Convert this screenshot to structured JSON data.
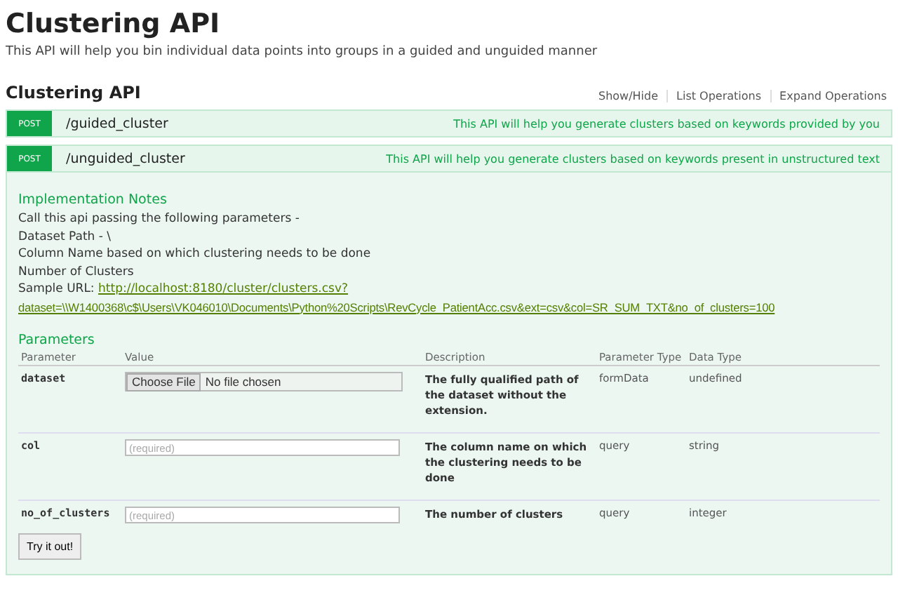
{
  "header": {
    "title": "Clustering API",
    "description": "This API will help you bin individual data points into groups in a guided and unguided manner"
  },
  "resource": {
    "name": "Clustering API",
    "links": [
      "Show/Hide",
      "List Operations",
      "Expand Operations"
    ],
    "operations": [
      {
        "method": "POST",
        "path": "/guided_cluster",
        "summary": "This API will help you generate clusters based on keywords provided by you",
        "expanded": false
      },
      {
        "method": "POST",
        "path": "/unguided_cluster",
        "summary": "This API will help you generate clusters based on keywords present in unstructured text",
        "expanded": true,
        "notes_title": "Implementation Notes",
        "notes": [
          "Call this api passing the following parameters -",
          "Dataset Path - \\",
          "Column Name based on which clustering needs to be done",
          "Number of Clusters"
        ],
        "sample_label": "Sample URL:",
        "sample_url": [
          "http://localhost:8180/cluster/clusters.csv?",
          "dataset=\\\\W1400368\\c$\\Users\\VK046010\\Documents\\Python%20Scripts\\RevCycle_PatientAcc.csv&ext=csv&col=SR_SUM_TXT&no_of_clusters=100"
        ],
        "params_title": "Parameters",
        "columns": [
          "Parameter",
          "Value",
          "Description",
          "Parameter Type",
          "Data Type"
        ],
        "params": [
          {
            "name": "dataset",
            "kind": "file",
            "button": "Choose File",
            "file_status": "No file chosen",
            "description": "The fully qualified path of the dataset without the extension.",
            "param_type": "formData",
            "data_type": "undefined"
          },
          {
            "name": "col",
            "kind": "text",
            "placeholder": "(required)",
            "description": "The column name on which the clustering needs to be done",
            "param_type": "query",
            "data_type": "string"
          },
          {
            "name": "no_of_clusters",
            "kind": "text",
            "placeholder": "(required)",
            "description": "The number of clusters",
            "param_type": "query",
            "data_type": "integer"
          }
        ],
        "submit": "Try it out!"
      }
    ]
  }
}
